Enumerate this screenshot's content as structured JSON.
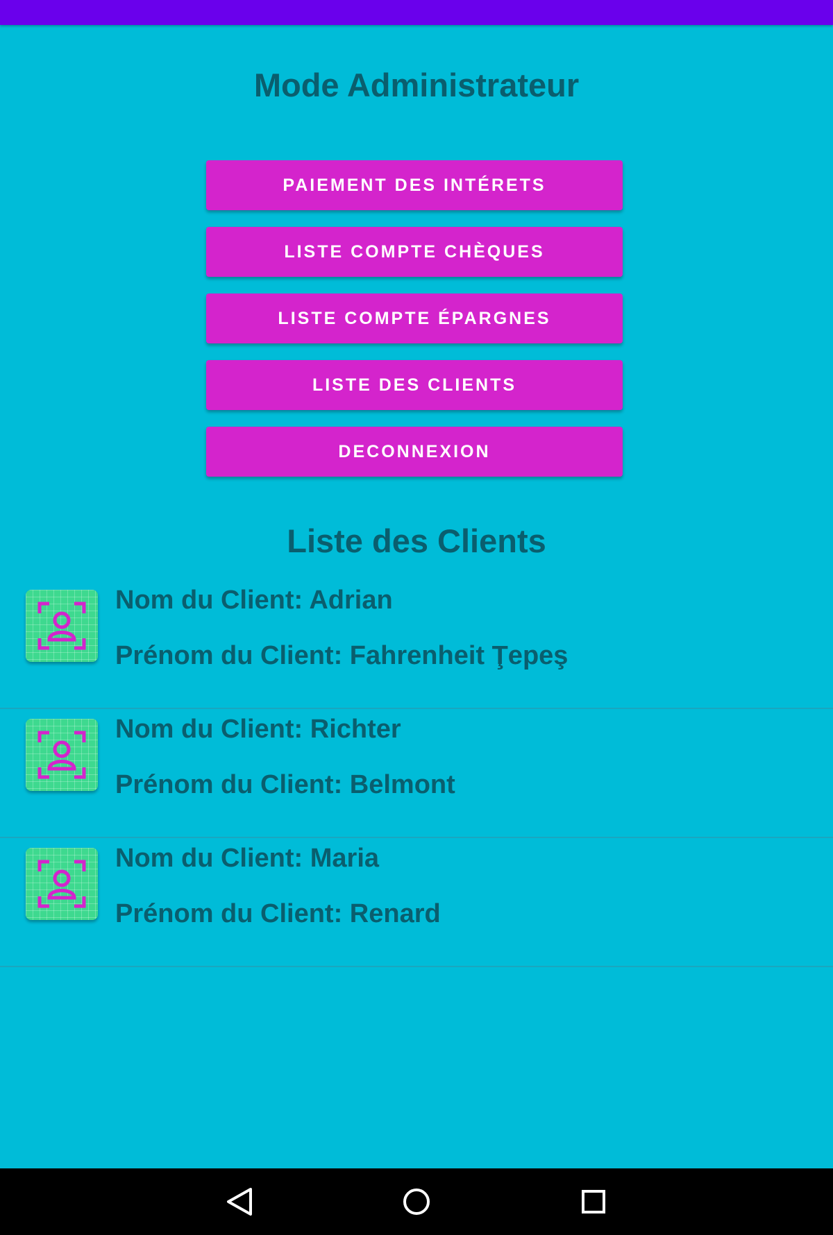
{
  "header": {
    "title": "Mode Administrateur"
  },
  "menu": {
    "buttons": [
      {
        "label": "PAIEMENT DES INTÉRETS"
      },
      {
        "label": "LISTE COMPTE CHÈQUES"
      },
      {
        "label": "LISTE COMPTE ÉPARGNES"
      },
      {
        "label": "LISTE DES CLIENTS"
      },
      {
        "label": "DECONNEXION"
      }
    ]
  },
  "clients": {
    "title": "Liste des Clients",
    "items": [
      {
        "nom": "Nom du Client: Adrian",
        "prenom": "Prénom du Client: Fahrenheit Ţepeş",
        "icon": "person-focus-icon"
      },
      {
        "nom": "Nom du Client: Richter",
        "prenom": "Prénom du Client: Belmont",
        "icon": "person-focus-icon"
      },
      {
        "nom": "Nom du Client: Maria",
        "prenom": "Prénom du Client: Renard",
        "icon": "person-focus-icon"
      }
    ]
  },
  "navigation": {
    "back_icon": "triangle-back-icon",
    "home_icon": "circle-home-icon",
    "recents_icon": "square-recents-icon"
  },
  "colors": {
    "status_bar": "#6a00ec",
    "background": "#00bcd8",
    "button": "#d424cc",
    "text": "#0a5e6e",
    "avatar": "#3ed98f",
    "avatar_icon": "#d424cc"
  }
}
